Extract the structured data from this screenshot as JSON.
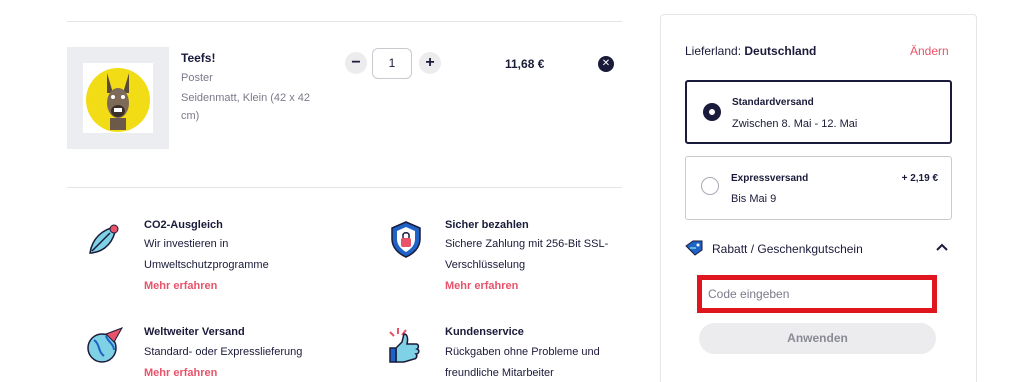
{
  "cart": {
    "item": {
      "title": "Teefs!",
      "type": "Poster",
      "variant_line1": "Seidenmatt, Klein (42 x 42",
      "variant_line2": "cm)",
      "quantity": "1",
      "minus_label": "−",
      "plus_label": "+",
      "price": "11,68 €",
      "remove_label": "✕"
    }
  },
  "features": [
    {
      "title": "CO2-Ausgleich",
      "line1": "Wir investieren in",
      "line2": "Umweltschutzprogramme",
      "link": "Mehr erfahren",
      "icon": "leaf-bug-icon"
    },
    {
      "title": "Sicher bezahlen",
      "line1": "Sichere Zahlung mit 256-Bit SSL-",
      "line2": "Verschlüsselung",
      "link": "Mehr erfahren",
      "icon": "shield-lock-icon"
    },
    {
      "title": "Weltweiter Versand",
      "line1": "Standard- oder Expresslieferung",
      "line2": "",
      "link": "Mehr erfahren",
      "icon": "globe-plane-icon"
    },
    {
      "title": "Kundenservice",
      "line1": "Rückgaben ohne Probleme und",
      "line2": "freundliche Mitarbeiter",
      "link": "",
      "icon": "thumbs-up-icon"
    }
  ],
  "shipping": {
    "country_label": "Lieferland: ",
    "country": "Deutschland",
    "change": "Ändern",
    "options": [
      {
        "name": "Standardversand",
        "date": "Zwischen 8. Mai - 12. Mai",
        "price": "",
        "selected": true
      },
      {
        "name": "Expressversand",
        "date": "Bis Mai 9",
        "price": "+ 2,19 €",
        "selected": false
      }
    ]
  },
  "coupon": {
    "label": "Rabatt / Geschenkgutschein",
    "placeholder": "Code eingeben",
    "value": "",
    "apply": "Anwenden"
  },
  "colors": {
    "accent": "#e8536a",
    "navy": "#1a1a3a",
    "highlight": "#e0161e"
  }
}
